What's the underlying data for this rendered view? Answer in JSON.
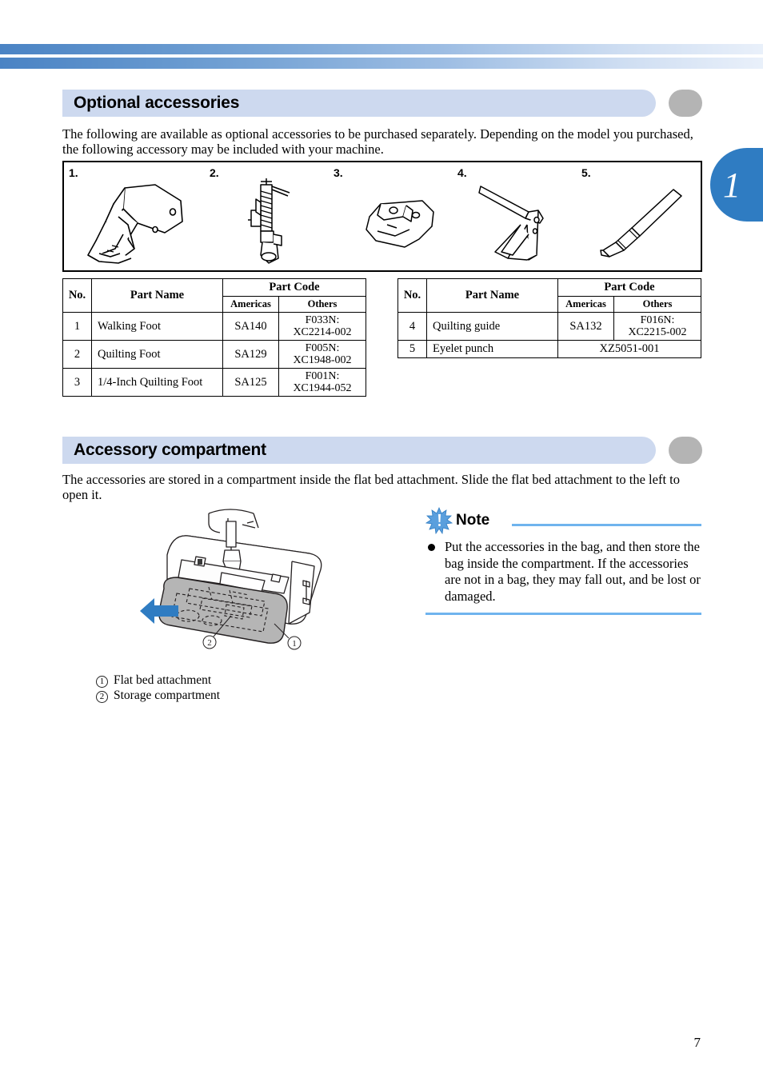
{
  "page": {
    "number": "7",
    "chapter_tab": "1"
  },
  "sections": [
    {
      "id": "optional-accessories",
      "title": "Optional accessories",
      "intro": "The following are available as optional accessories to be purchased separately. Depending on the model you purchased, the following accessory may be included with your machine."
    },
    {
      "id": "accessory-compartment",
      "title": "Accessory compartment",
      "intro": "The accessories are stored in a compartment inside the flat bed attachment. Slide the flat bed attachment to the left to open it."
    }
  ],
  "accessory_figure": {
    "items": [
      {
        "label": "1.",
        "icon": "walking-foot-illustration"
      },
      {
        "label": "2.",
        "icon": "quilting-foot-illustration"
      },
      {
        "label": "3.",
        "icon": "quarter-inch-quilting-foot-illustration"
      },
      {
        "label": "4.",
        "icon": "quilting-guide-illustration"
      },
      {
        "label": "5.",
        "icon": "eyelet-punch-illustration"
      }
    ]
  },
  "tables": {
    "headers": {
      "no": "No.",
      "part_name": "Part Name",
      "part_code": "Part Code",
      "americas": "Americas",
      "others": "Others"
    },
    "left": {
      "rows": [
        {
          "no": "1",
          "name": "Walking Foot",
          "americas": "SA140",
          "others": "F033N:\nXC2214-002"
        },
        {
          "no": "2",
          "name": "Quilting Foot",
          "americas": "SA129",
          "others": "F005N:\nXC1948-002"
        },
        {
          "no": "3",
          "name": "1/4-Inch Quilting Foot",
          "americas": "SA125",
          "others": "F001N:\nXC1944-052"
        }
      ]
    },
    "right": {
      "rows": [
        {
          "no": "4",
          "name": "Quilting guide",
          "americas": "SA132",
          "others": "F016N:\nXC2215-002",
          "span": false
        },
        {
          "no": "5",
          "name": "Eyelet punch",
          "americas": "",
          "others": "XZ5051-001",
          "span": true
        }
      ]
    }
  },
  "illustration": {
    "name": "sewing-machine-flat-bed-attachment",
    "callouts": [
      {
        "num": "1",
        "label": "Flat bed attachment"
      },
      {
        "num": "2",
        "label": "Storage compartment"
      }
    ],
    "arrow_direction": "left",
    "arrow_color": "#2f7cc2"
  },
  "note": {
    "title": "Note",
    "icon": "note-burst-icon",
    "text": "Put the accessories in the bag, and then store the bag inside the compartment. If the accessories are not in a bag, they may fall out, and be lost or damaged.",
    "rule_color": "#6fb4ee"
  },
  "colors": {
    "header_bar": "#cdd9ef",
    "header_cap": "#b4b4b4",
    "tab_blue": "#2f7cc2",
    "top_gradient_start": "#4a83c4",
    "top_gradient_end": "#e9f0fa"
  }
}
